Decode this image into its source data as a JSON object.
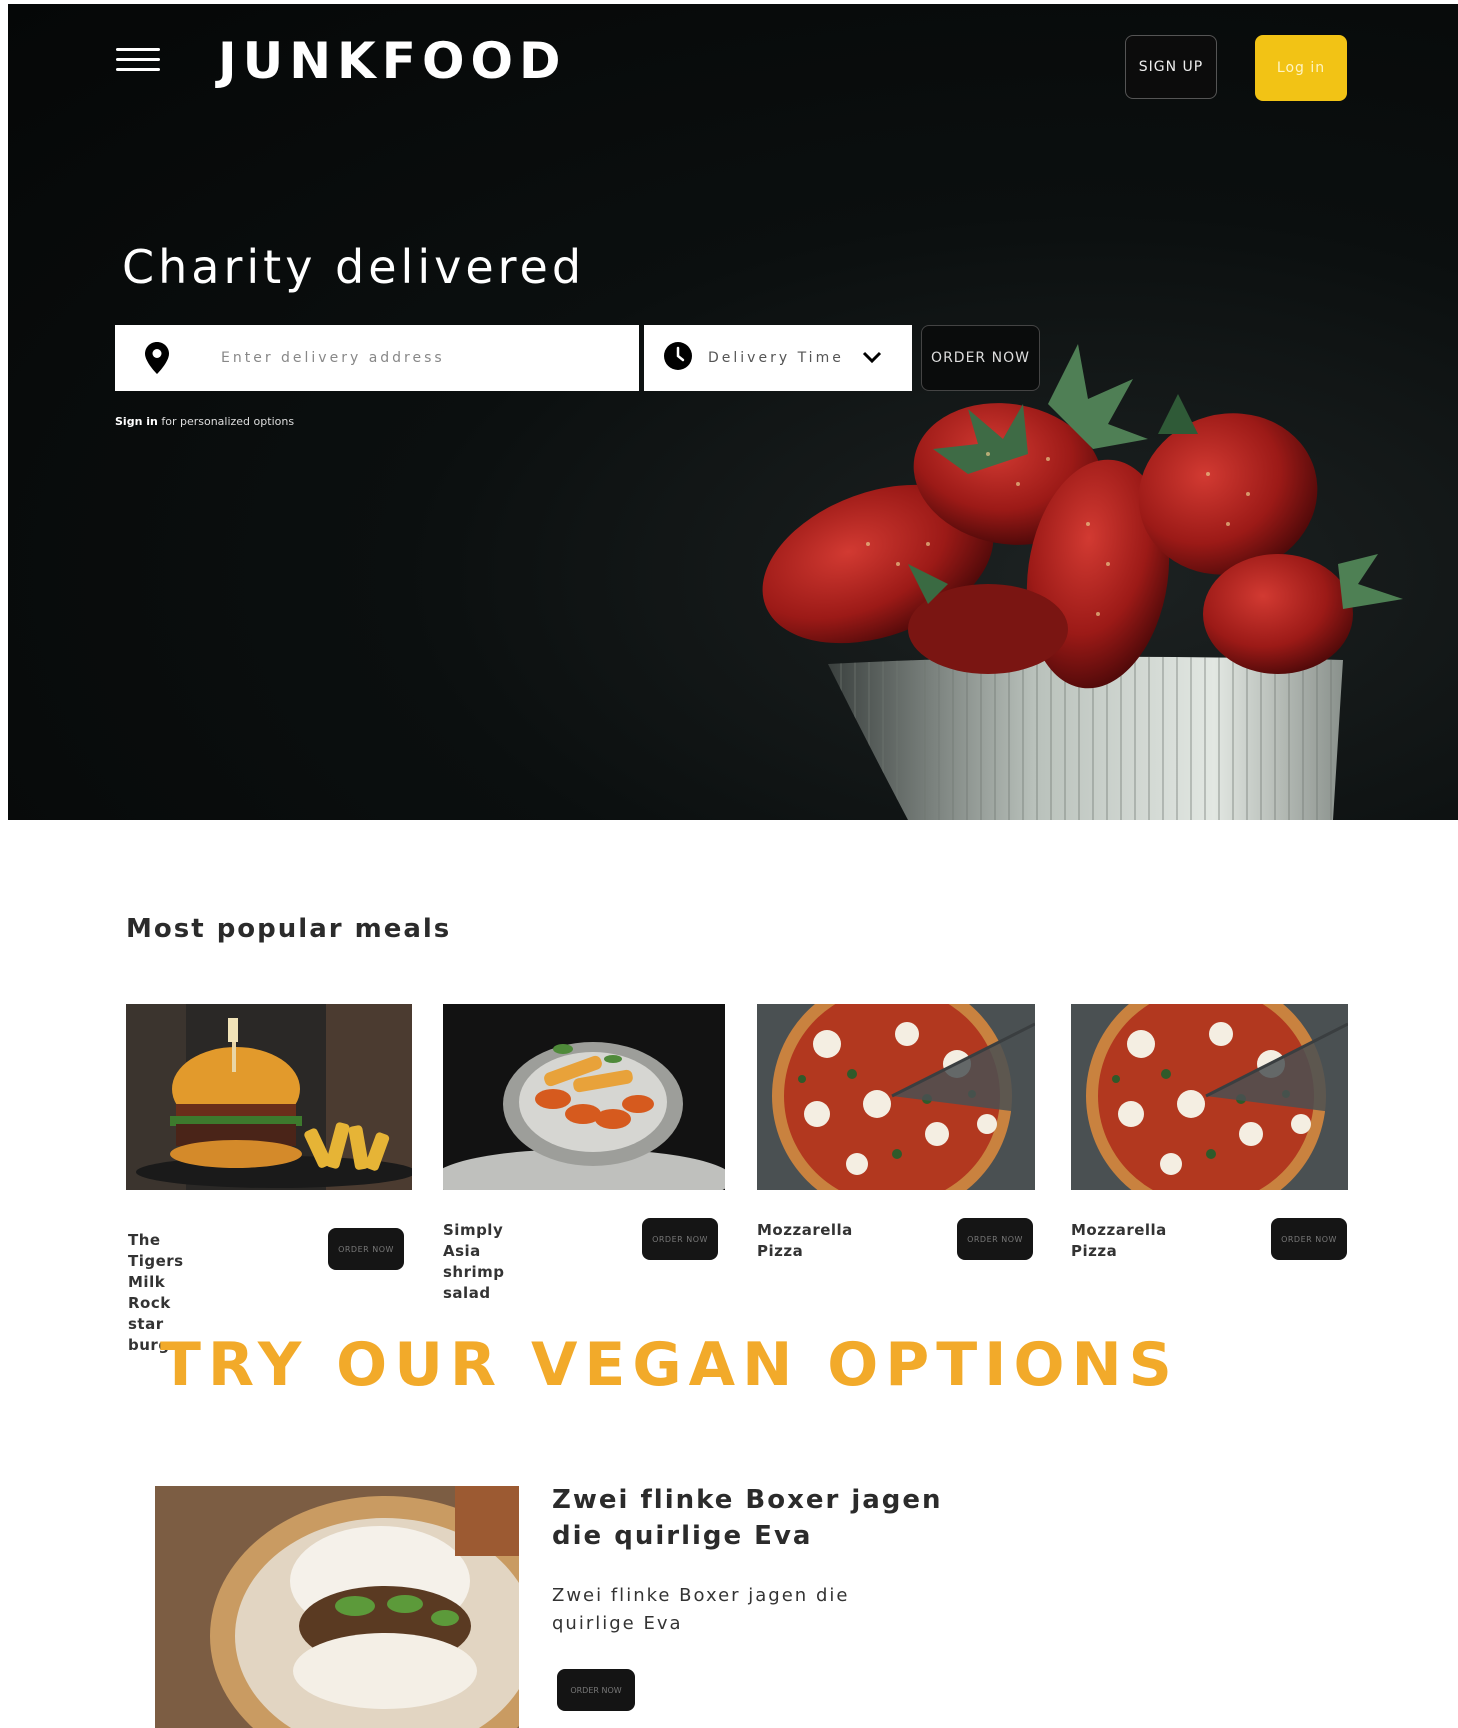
{
  "header": {
    "logo": "JUNKFOOD",
    "signup_label": "SIGN UP",
    "login_label": "Log in",
    "login_color": "#f2c315"
  },
  "hero": {
    "headline": "Charity delivered",
    "address_placeholder": "Enter delivery address",
    "time_label": "Delivery Time",
    "order_label": "ORDER NOW",
    "signin_link": "Sign in",
    "signin_rest": " for personalized options"
  },
  "popular": {
    "title": "Most popular meals",
    "items": [
      {
        "name_line1": "The Tigers Milk",
        "name_line2": "Rock star burger",
        "button": "ORDER NOW",
        "image": "burger"
      },
      {
        "name_line1": "Simply Asia shrimp",
        "name_line2": "salad",
        "button": "ORDER NOW",
        "image": "shrimp"
      },
      {
        "name_line1": "Mozzarella Pizza",
        "name_line2": "",
        "button": "ORDER NOW",
        "image": "pizza"
      },
      {
        "name_line1": "Mozzarella Pizza",
        "name_line2": "",
        "button": "ORDER NOW",
        "image": "pizza"
      }
    ]
  },
  "vegan": {
    "title": "TRY OUR VEGAN OPTIONS",
    "title_color": "#f2aa2a",
    "heading": "Zwei flinke Boxer jagen die quirlige Eva",
    "text": "Zwei flinke Boxer jagen die quirlige Eva",
    "button": "ORDER NOW"
  }
}
